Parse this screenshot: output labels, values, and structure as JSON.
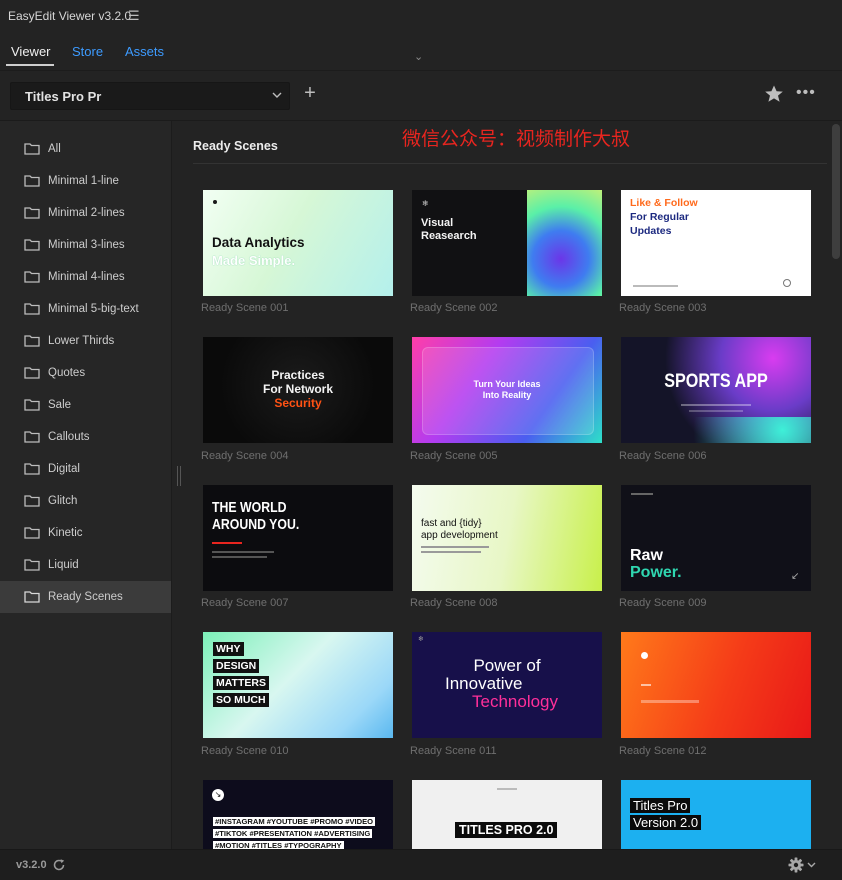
{
  "app": {
    "title": "EasyEdit Viewer v3.2.0",
    "menu_icon": "hamburger-menu-icon"
  },
  "tabs": [
    {
      "label": "Viewer",
      "active": true
    },
    {
      "label": "Store",
      "active": false
    },
    {
      "label": "Assets",
      "active": false
    }
  ],
  "toolbar": {
    "pack_selected": "Titles Pro Pr",
    "add_label": "+",
    "more_label": "•••"
  },
  "sidebar": {
    "items": [
      {
        "label": "All"
      },
      {
        "label": "Minimal 1-line"
      },
      {
        "label": "Minimal 2-lines"
      },
      {
        "label": "Minimal 3-lines"
      },
      {
        "label": "Minimal 4-lines"
      },
      {
        "label": "Minimal 5-big-text"
      },
      {
        "label": "Lower Thirds"
      },
      {
        "label": "Quotes"
      },
      {
        "label": "Sale"
      },
      {
        "label": "Callouts"
      },
      {
        "label": "Digital"
      },
      {
        "label": "Glitch"
      },
      {
        "label": "Kinetic"
      },
      {
        "label": "Liquid"
      },
      {
        "label": "Ready Scenes",
        "active": true
      }
    ]
  },
  "main": {
    "section_title": "Ready Scenes",
    "watermark": "微信公众号：视频制作大叔",
    "scenes": [
      {
        "caption": "Ready Scene 001",
        "lines": [
          "Data Analytics",
          "Made Simple."
        ]
      },
      {
        "caption": "Ready Scene 002",
        "lines": [
          "Visual",
          "Reasearch"
        ]
      },
      {
        "caption": "Ready Scene 003",
        "lines": [
          "Like & Follow",
          "For Regular",
          "Updates"
        ]
      },
      {
        "caption": "Ready Scene 004",
        "lines": [
          "Practices",
          "For Network",
          "Security"
        ]
      },
      {
        "caption": "Ready Scene 005",
        "lines": [
          "Turn Your Ideas",
          "Into Reality"
        ]
      },
      {
        "caption": "Ready Scene 006",
        "lines": [
          "SPORTS APP"
        ]
      },
      {
        "caption": "Ready Scene 007",
        "lines": [
          "THE WORLD",
          "AROUND YOU."
        ]
      },
      {
        "caption": "Ready Scene 008",
        "lines": [
          "fast and {tidy}",
          "app development"
        ]
      },
      {
        "caption": "Ready Scene 009",
        "lines": [
          "Raw",
          "Power."
        ]
      },
      {
        "caption": "Ready Scene 010",
        "lines": [
          "WHY",
          "DESIGN",
          "MATTERS",
          "SO MUCH"
        ]
      },
      {
        "caption": "Ready Scene 011",
        "lines": [
          "Power of",
          "Innovative",
          "Technology"
        ]
      },
      {
        "caption": "Ready Scene 012",
        "lines": []
      },
      {
        "caption": "",
        "lines": [
          "#INSTAGRAM #YOUTUBE #PROMO #VIDEO",
          "#TIKTOK #PRESENTATION #ADVERTISING",
          "#MOTION #TITLES #TYPOGRAPHY"
        ]
      },
      {
        "caption": "",
        "lines": [
          "TITLES PRO 2.0"
        ]
      },
      {
        "caption": "",
        "lines": [
          "Titles Pro",
          "Version 2.0"
        ]
      }
    ]
  },
  "statusbar": {
    "version": "v3.2.0"
  },
  "colors": {
    "accent": "#3d9bff",
    "watermark": "#e8251f",
    "background": "#232323"
  }
}
